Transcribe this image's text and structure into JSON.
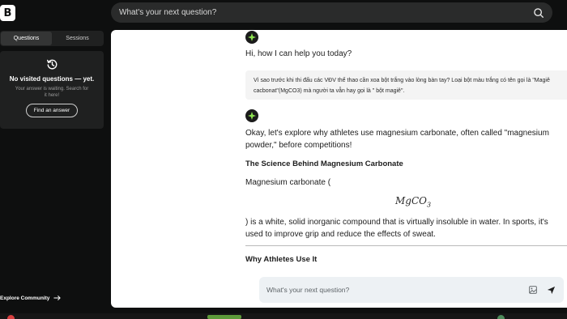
{
  "app": {
    "logo_letter": "B"
  },
  "top_search": {
    "placeholder": "What's your next question?",
    "icon": "search-icon"
  },
  "sidebar": {
    "tabs": [
      {
        "label": "Questions",
        "active": true
      },
      {
        "label": "Sessions",
        "active": false
      }
    ],
    "empty_state": {
      "icon": "history-icon",
      "title": "No visited questions — yet.",
      "text": "Your answer is waiting. Search for it here!",
      "button": "Find an answer"
    },
    "explore": "Explore Community"
  },
  "chat": {
    "greeting": "Hi, how I can help you today?",
    "user_message": "Vì sao trước khi thi đấu các VĐV thể thao cần xoa bột trắng vào lòng bàn tay? Loại bột màu trắng có tên gọi là \"Magiê cacbonat\"(MgCO3) mà người ta vẫn hay gọi là \" bột magiê\".",
    "answer": {
      "intro": "Okay, let's explore why athletes use magnesium carbonate, often called \"magnesium powder,\" before competitions!",
      "heading1": "The Science Behind Magnesium Carbonate",
      "para1_start": "Magnesium carbonate (",
      "formula_base": "MgCO",
      "formula_sub": "3",
      "para1_end": ") is a white, solid inorganic compound that is virtually insoluble in water. In sports, it's used to improve grip and reduce the effects of sweat.",
      "heading2": "Why Athletes Use It"
    }
  },
  "ask_bar": {
    "placeholder": "What's your next question?",
    "icons": [
      "image-icon",
      "send-icon"
    ]
  },
  "colors": {
    "background": "#0e0f0f",
    "panel": "#ffffff",
    "accent_green": "#8be04e",
    "ask_bar": "#edf1f4"
  }
}
